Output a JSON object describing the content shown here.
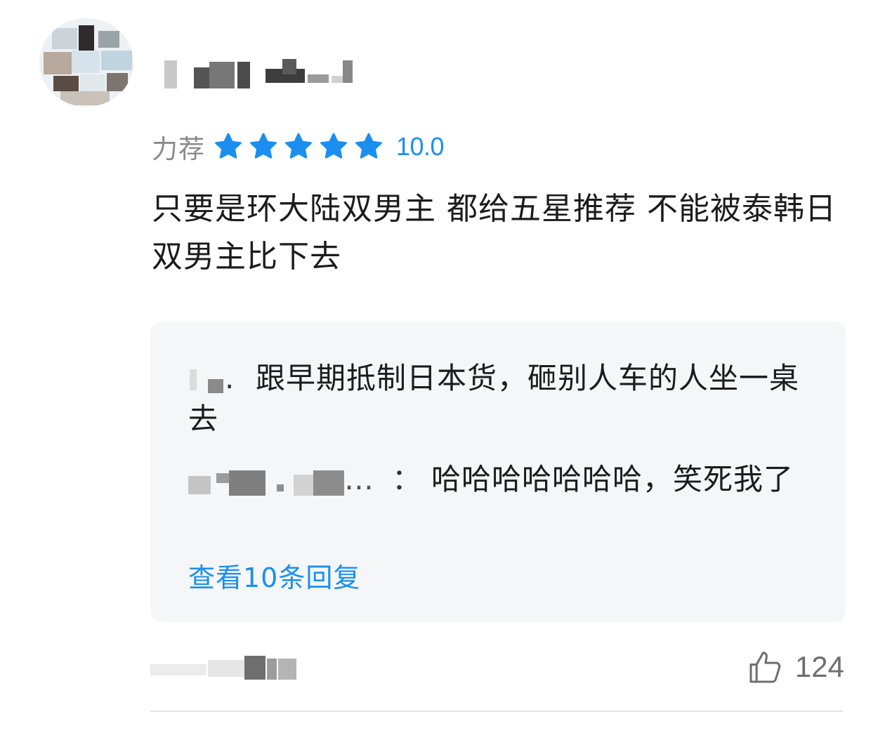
{
  "comment": {
    "rating_label": "力荐",
    "rating_stars": 5,
    "rating_max": 5,
    "rating_score": "10.0",
    "text": "只要是环大陆双男主 都给五星推荐 不能被泰韩日双男主比下去",
    "likes": "124"
  },
  "replies": [
    {
      "author_visible": "",
      "separator": ".",
      "text": "跟早期抵制日本货，砸别人车的人坐一桌去"
    },
    {
      "author_visible": "…",
      "separator": "：",
      "text": "哈哈哈哈哈哈哈，笑死我了"
    }
  ],
  "view_replies_label": "查看10条回复",
  "colors": {
    "accent": "#1a8ff0",
    "star": "#1a8ff0",
    "reply_bg": "#f5f6f8",
    "muted": "#8a8a8a"
  },
  "icons": {
    "star": "star-icon",
    "like": "thumbs-up-icon"
  }
}
